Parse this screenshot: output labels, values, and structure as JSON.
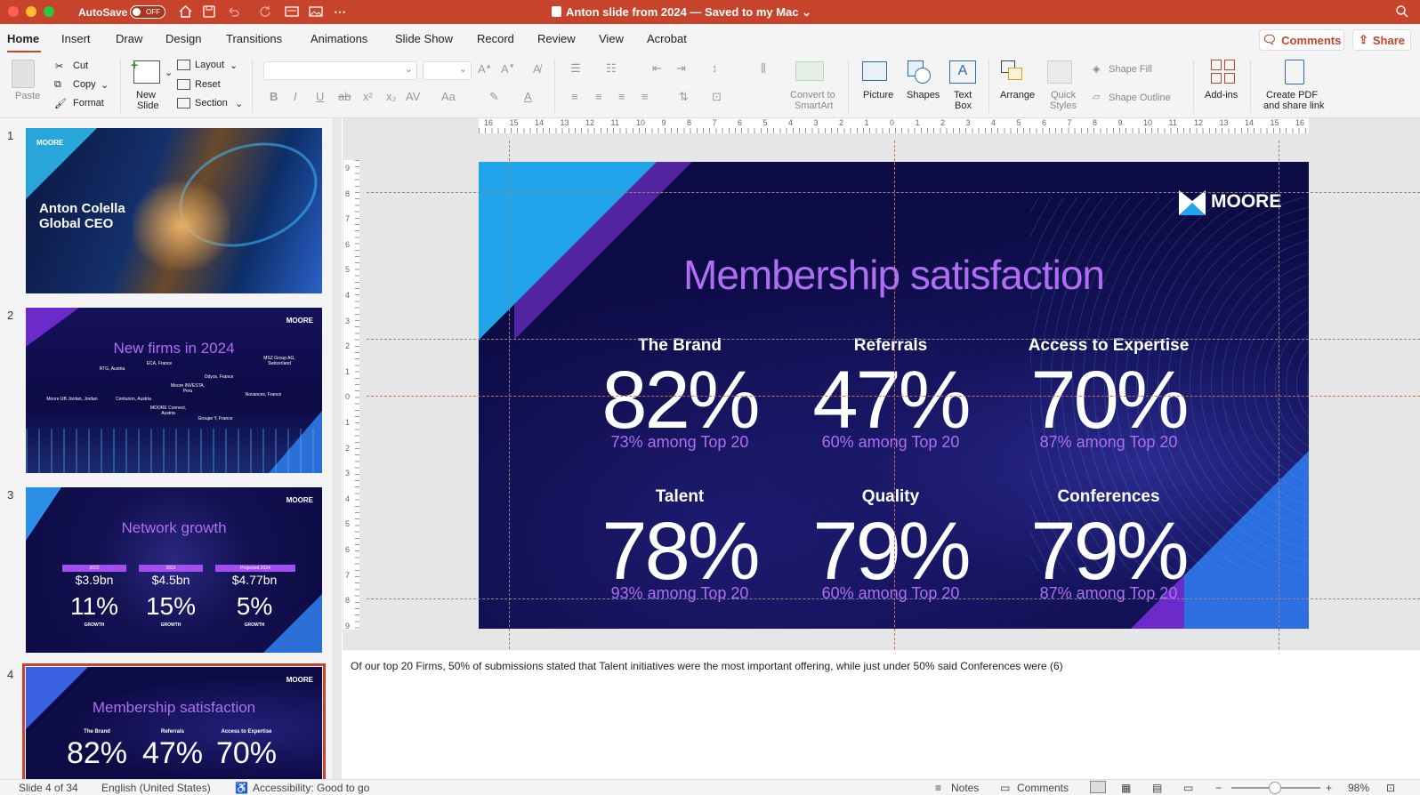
{
  "titlebar": {
    "autosave_label": "AutoSave",
    "autosave_state": "OFF",
    "doc_title": "Anton slide from 2024 — Saved to my Mac"
  },
  "tabs": [
    {
      "label": "Home"
    },
    {
      "label": "Insert"
    },
    {
      "label": "Draw"
    },
    {
      "label": "Design"
    },
    {
      "label": "Transitions"
    },
    {
      "label": "Animations"
    },
    {
      "label": "Slide Show"
    },
    {
      "label": "Record"
    },
    {
      "label": "Review"
    },
    {
      "label": "View"
    },
    {
      "label": "Acrobat"
    }
  ],
  "top_buttons": {
    "comments": "Comments",
    "share": "Share"
  },
  "ribbon": {
    "paste": "Paste",
    "cut": "Cut",
    "copy": "Copy",
    "format": "Format",
    "new_slide_1": "New",
    "new_slide_2": "Slide",
    "layout": "Layout",
    "reset": "Reset",
    "section": "Section",
    "smartart_1": "Convert to",
    "smartart_2": "SmartArt",
    "picture": "Picture",
    "shapes": "Shapes",
    "textbox_1": "Text",
    "textbox_2": "Box",
    "arrange": "Arrange",
    "quick_styles_1": "Quick",
    "quick_styles_2": "Styles",
    "shape_fill": "Shape Fill",
    "shape_outline": "Shape Outline",
    "addins": "Add-ins",
    "pdf_1": "Create PDF",
    "pdf_2": "and share link"
  },
  "ruler": {
    "top": [
      "16",
      "15",
      "14",
      "13",
      "12",
      "11",
      "10",
      "9",
      "8",
      "7",
      "6",
      "5",
      "4",
      "3",
      "2",
      "1",
      "0",
      "1",
      "2",
      "3",
      "4",
      "5",
      "6",
      "7",
      "8",
      "9",
      "10",
      "11",
      "12",
      "13",
      "14",
      "15",
      "16"
    ],
    "side": [
      "9",
      "8",
      "7",
      "6",
      "5",
      "4",
      "3",
      "2",
      "1",
      "0",
      "1",
      "2",
      "3",
      "4",
      "5",
      "6",
      "7",
      "8",
      "9"
    ]
  },
  "thumbnails": [
    {
      "num": "1",
      "title_line1": "Anton Colella",
      "title_line2": "Global CEO",
      "logo": "MOORE"
    },
    {
      "num": "2",
      "title": "New firms in 2024",
      "logo": "MOORE",
      "pins": [
        "RTG, Austria",
        "ECA, France",
        "MSZ Group AG, Switzerland",
        "Moore UB Jordan, Jordan",
        "Centurion, Austria",
        "Moore INVESTA, Peru",
        "Odyce, France",
        "Novances, France",
        "MOORE Connect, Austria",
        "Groupe Y, France"
      ]
    },
    {
      "num": "3",
      "title": "Network growth",
      "logo": "MOORE",
      "cols": [
        {
          "year": "2022",
          "amount": "$3.9bn",
          "pct": "11%",
          "label": "GROWTH"
        },
        {
          "year": "2023",
          "amount": "$4.5bn",
          "pct": "15%",
          "label": "GROWTH"
        },
        {
          "year": "Projected 2024",
          "amount": "$4.77bn",
          "pct": "5%",
          "label": "GROWTH"
        }
      ]
    },
    {
      "num": "4",
      "title": "Membership satisfaction",
      "logo": "MOORE",
      "stats": [
        {
          "label": "The Brand",
          "value": "82%"
        },
        {
          "label": "Referrals",
          "value": "47%"
        },
        {
          "label": "Access to Expertise",
          "value": "70%"
        }
      ]
    }
  ],
  "slide": {
    "logo": "MOORE",
    "title": "Membership satisfaction",
    "stats": [
      {
        "label": "The Brand",
        "value": "82%",
        "sub": "73% among Top 20"
      },
      {
        "label": "Referrals",
        "value": "47%",
        "sub": "60% among Top 20"
      },
      {
        "label": "Access to Expertise",
        "value": "70%",
        "sub": "87% among Top 20"
      },
      {
        "label": "Talent",
        "value": "78%",
        "sub": "93% among Top 20"
      },
      {
        "label": "Quality",
        "value": "79%",
        "sub": "60% among Top 20"
      },
      {
        "label": "Conferences",
        "value": "79%",
        "sub": "87% among Top 20"
      }
    ]
  },
  "notes": "Of our top 20 Firms, 50% of submissions stated that Talent initiatives were the most important offering, while just under 50% said Conferences were (6)",
  "status": {
    "slide": "Slide 4 of 34",
    "language": "English (United States)",
    "accessibility": "Accessibility: Good to go",
    "notes": "Notes",
    "comments": "Comments",
    "zoom": "98%"
  },
  "colors": {
    "accent": "#c7432c",
    "slide_bg": "#0d0b45",
    "title_purple": "#b06ef2"
  }
}
